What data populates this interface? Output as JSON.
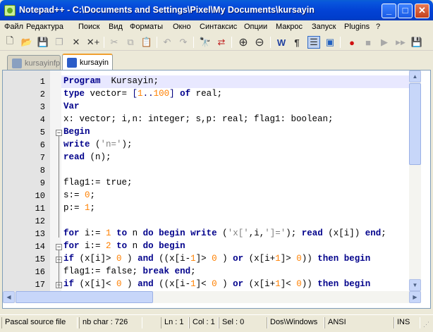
{
  "window": {
    "title": "Notepad++ - C:\\Documents and Settings\\Pixel\\My Documents\\kursayin"
  },
  "menu": [
    "Файл",
    "Редактура",
    "Поиск",
    "Вид",
    "Форматы",
    "Окно",
    "Синтаксис",
    "Опции",
    "Макрос",
    "Запуск",
    "Plugins",
    "?"
  ],
  "toolbar": {
    "icons": [
      "new-file",
      "open-file",
      "save",
      "save-all",
      "close",
      "close-all",
      "cut",
      "copy",
      "paste",
      "undo",
      "redo",
      "find",
      "replace",
      "zoom-in",
      "zoom-out",
      "wrap",
      "show-all-chars",
      "indent-guide",
      "user-lang",
      "record-macro",
      "stop-record",
      "play-macro",
      "play-multiple",
      "save-macro"
    ],
    "glyphs": {
      "new": "🗋",
      "open": "📂",
      "save": "💾",
      "saveall": "❐",
      "close": "✕",
      "closeall": "✕+",
      "cut": "✂",
      "copy": "⧉",
      "paste": "📋",
      "undo": "↶",
      "redo": "↷",
      "find": "🔭",
      "replace": "⇄",
      "zoomin": "⊕",
      "zoomout": "⊖",
      "wrap": "W",
      "pilcrow": "¶",
      "guide": "☰",
      "udl": "▣",
      "rec": "●",
      "stop": "■",
      "play": "▶",
      "playm": "▶▶",
      "savem": "💾"
    }
  },
  "tabs": [
    {
      "label": "kursayinfp",
      "active": false
    },
    {
      "label": "kursayin",
      "active": true
    }
  ],
  "editor": {
    "lines": [
      {
        "n": "1",
        "segs": [
          [
            "kw",
            "Program"
          ],
          [
            "",
            "  Kursayin;"
          ]
        ]
      },
      {
        "n": "2",
        "segs": [
          [
            "kw",
            "type"
          ],
          [
            "",
            " vector= "
          ],
          [
            "op",
            "["
          ],
          [
            "num",
            "1"
          ],
          [
            "op",
            ".."
          ],
          [
            "num",
            "100"
          ],
          [
            "op",
            "]"
          ],
          [
            "",
            " "
          ],
          [
            "kw",
            "of"
          ],
          [
            "",
            " real;"
          ]
        ]
      },
      {
        "n": "3",
        "segs": [
          [
            "kw",
            "Var"
          ]
        ]
      },
      {
        "n": "4",
        "segs": [
          [
            "",
            "x: vector; i,n: integer; s,p: real; flag1: boolean;"
          ]
        ]
      },
      {
        "n": "5",
        "segs": [
          [
            "kw",
            "Begin"
          ]
        ]
      },
      {
        "n": "6",
        "segs": [
          [
            "kw",
            "write"
          ],
          [
            "",
            " ("
          ],
          [
            "str",
            "'n='"
          ],
          [
            "",
            ");"
          ]
        ]
      },
      {
        "n": "7",
        "segs": [
          [
            "kw",
            "read"
          ],
          [
            "",
            " (n);"
          ]
        ]
      },
      {
        "n": "8",
        "segs": []
      },
      {
        "n": "9",
        "segs": [
          [
            "",
            "flag1:= true;"
          ]
        ]
      },
      {
        "n": "10",
        "segs": [
          [
            "",
            "s:= "
          ],
          [
            "num",
            "0"
          ],
          [
            "",
            ";"
          ]
        ]
      },
      {
        "n": "11",
        "segs": [
          [
            "",
            "p:= "
          ],
          [
            "num",
            "1"
          ],
          [
            "",
            ";"
          ]
        ]
      },
      {
        "n": "12",
        "segs": []
      },
      {
        "n": "13",
        "segs": [
          [
            "kw",
            "for"
          ],
          [
            "",
            " i:= "
          ],
          [
            "num",
            "1"
          ],
          [
            "",
            " "
          ],
          [
            "kw",
            "to"
          ],
          [
            "",
            " n "
          ],
          [
            "kw",
            "do"
          ],
          [
            "",
            " "
          ],
          [
            "kw",
            "begin"
          ],
          [
            "",
            " "
          ],
          [
            "kw",
            "write"
          ],
          [
            "",
            " ("
          ],
          [
            "str",
            "'x['"
          ],
          [
            "",
            ",i,"
          ],
          [
            "str",
            "']='"
          ],
          [
            "",
            "); "
          ],
          [
            "kw",
            "read"
          ],
          [
            "",
            " (x[i]) "
          ],
          [
            "kw",
            "end"
          ],
          [
            "",
            ";"
          ]
        ]
      },
      {
        "n": "14",
        "segs": [
          [
            "kw",
            "for"
          ],
          [
            "",
            " i:= "
          ],
          [
            "num",
            "2"
          ],
          [
            "",
            " "
          ],
          [
            "kw",
            "to"
          ],
          [
            "",
            " n "
          ],
          [
            "kw",
            "do"
          ],
          [
            "",
            " "
          ],
          [
            "kw",
            "begin"
          ]
        ]
      },
      {
        "n": "15",
        "segs": [
          [
            "kw",
            "if"
          ],
          [
            "",
            " (x[i]> "
          ],
          [
            "num",
            "0"
          ],
          [
            "",
            " ) "
          ],
          [
            "kw",
            "and"
          ],
          [
            "",
            " ((x[i-"
          ],
          [
            "num",
            "1"
          ],
          [
            "",
            "]> "
          ],
          [
            "num",
            "0"
          ],
          [
            "",
            " ) "
          ],
          [
            "kw",
            "or"
          ],
          [
            "",
            " (x[i+"
          ],
          [
            "num",
            "1"
          ],
          [
            "",
            "]> "
          ],
          [
            "num",
            "0"
          ],
          [
            "",
            ")) "
          ],
          [
            "kw",
            "then"
          ],
          [
            "",
            " "
          ],
          [
            "kw",
            "begin"
          ]
        ]
      },
      {
        "n": "16",
        "segs": [
          [
            "",
            "flag1:= false; "
          ],
          [
            "kw",
            "break"
          ],
          [
            "",
            " "
          ],
          [
            "kw",
            "end"
          ],
          [
            "",
            ";"
          ]
        ]
      },
      {
        "n": "17",
        "segs": [
          [
            "kw",
            "if"
          ],
          [
            "",
            " (x[i]< "
          ],
          [
            "num",
            "0"
          ],
          [
            "",
            " ) "
          ],
          [
            "kw",
            "and"
          ],
          [
            "",
            " ((x[i-"
          ],
          [
            "num",
            "1"
          ],
          [
            "",
            "]< "
          ],
          [
            "num",
            "0"
          ],
          [
            "",
            " ) "
          ],
          [
            "kw",
            "or"
          ],
          [
            "",
            " (x[i+"
          ],
          [
            "num",
            "1"
          ],
          [
            "",
            "]< "
          ],
          [
            "num",
            "0"
          ],
          [
            "",
            ")) "
          ],
          [
            "kw",
            "then"
          ],
          [
            "",
            " "
          ],
          [
            "kw",
            "begin"
          ]
        ]
      }
    ],
    "current_line": 1,
    "fold_markers": {
      "5": "−",
      "14": "−",
      "15": "−",
      "17": "−"
    },
    "scroll": {
      "vertical_fraction": 0.42,
      "horizontal_fraction": 0.35
    }
  },
  "status": {
    "filetype": "Pascal source file",
    "nbchar": "nb char : 726",
    "ln": "Ln : 1",
    "col": "Col : 1",
    "sel": "Sel : 0",
    "eol": "Dos\\Windows",
    "encoding": "ANSI",
    "mode": "INS"
  },
  "colors": {
    "keyword": "#00008b",
    "number": "#ff8000",
    "string": "#808080",
    "current_line": "#e8e8ff"
  }
}
